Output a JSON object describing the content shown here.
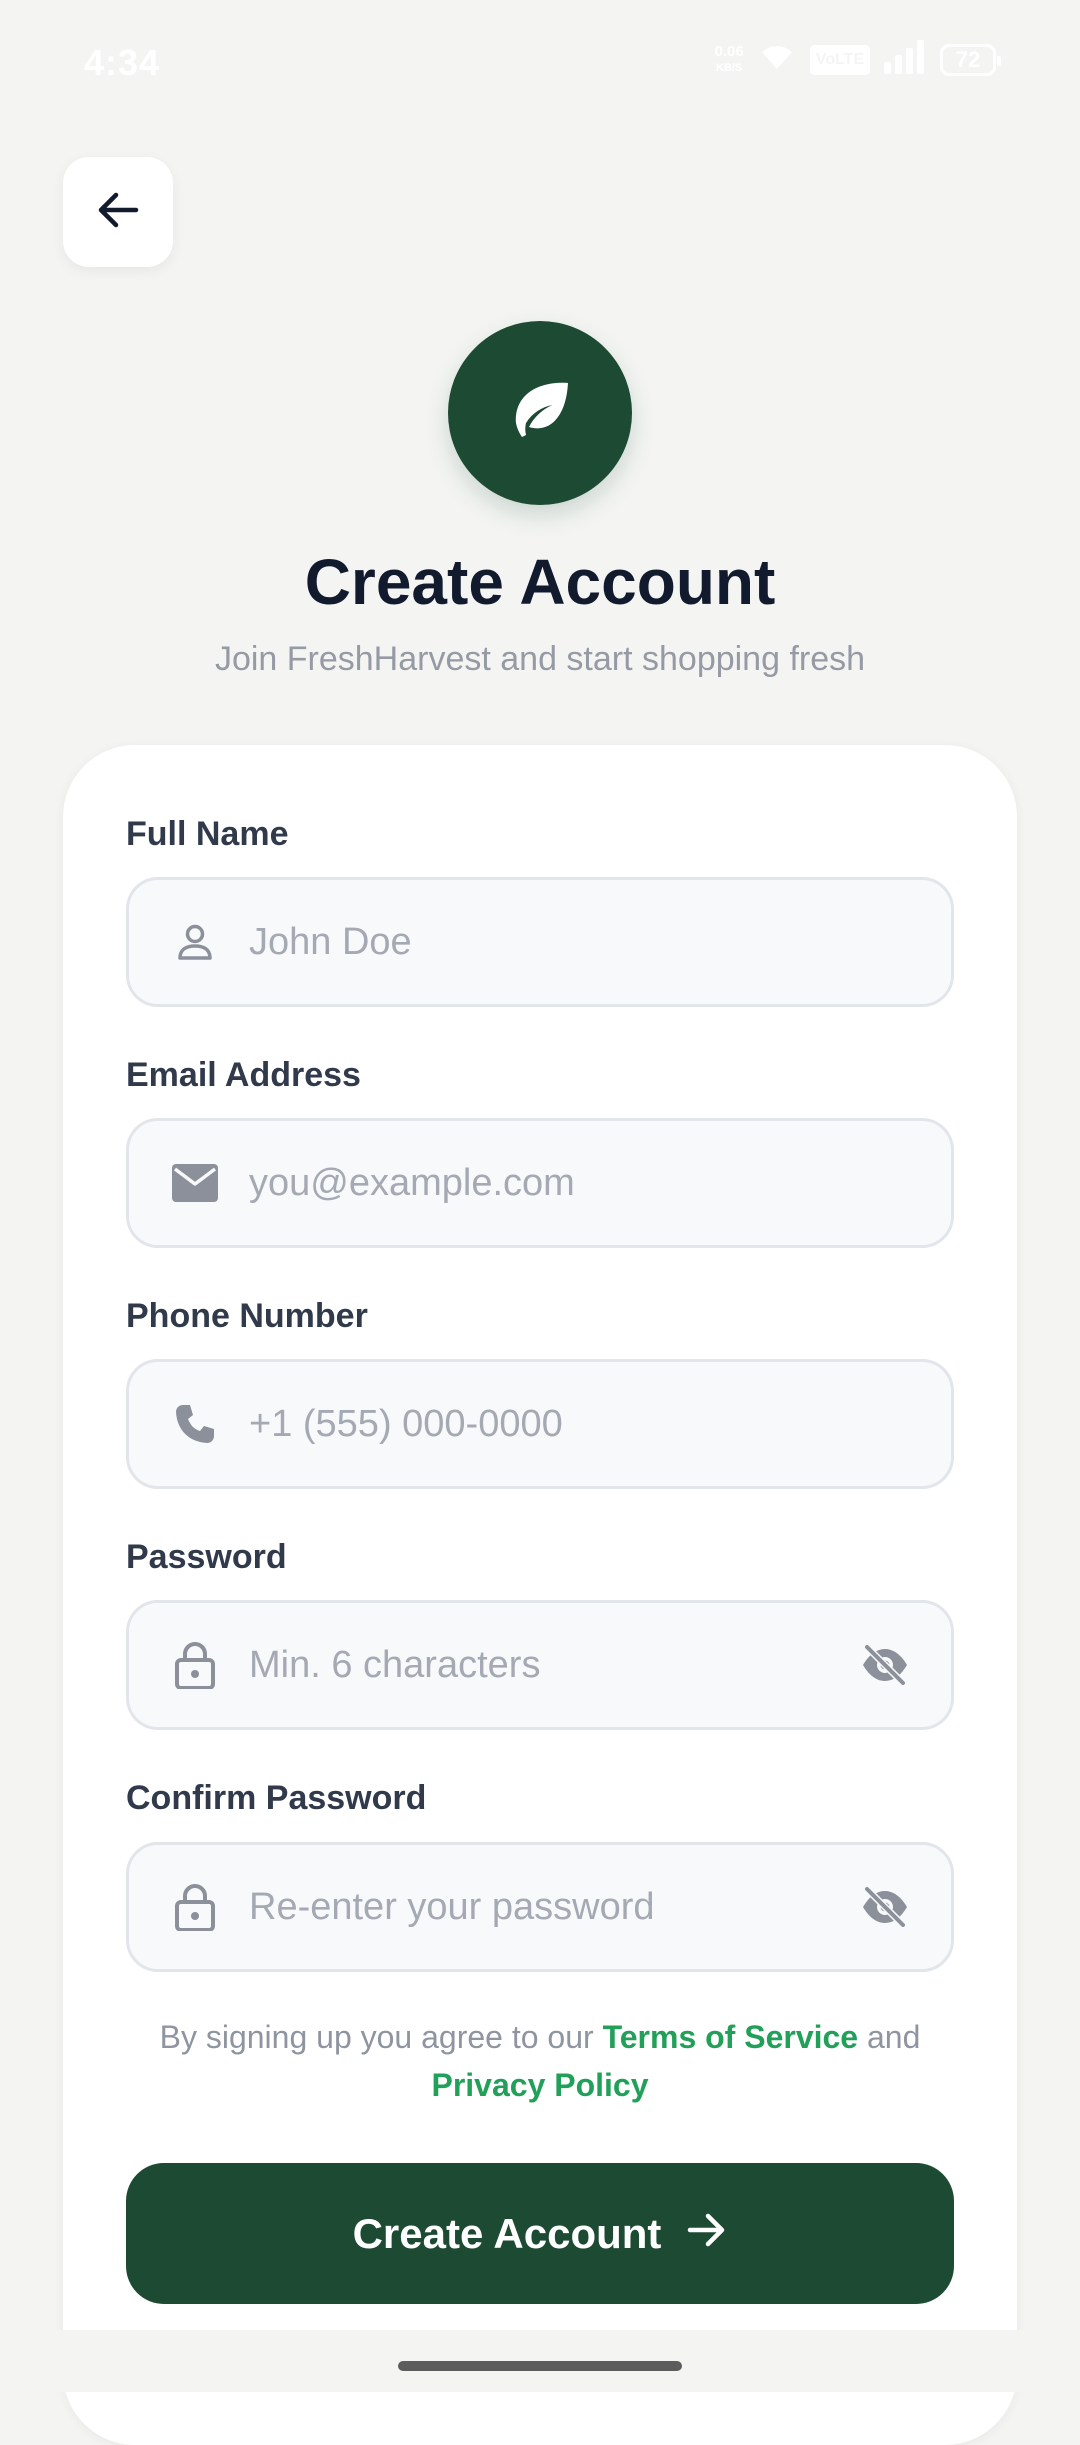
{
  "status_bar": {
    "time": "4:34",
    "net_speed_value": "0.06",
    "net_speed_unit": "KB/S",
    "volte_label": "VoLTE",
    "battery_level": "72"
  },
  "header": {
    "title": "Create Account",
    "subtitle": "Join FreshHarvest and start shopping fresh"
  },
  "form": {
    "full_name": {
      "label": "Full Name",
      "placeholder": "John Doe",
      "icon": "person-icon"
    },
    "email": {
      "label": "Email Address",
      "placeholder": "you@example.com",
      "icon": "mail-icon"
    },
    "phone": {
      "label": "Phone Number",
      "placeholder": "+1 (555) 000-0000",
      "icon": "phone-icon"
    },
    "password": {
      "label": "Password",
      "placeholder": "Min. 6 characters",
      "icon": "lock-icon"
    },
    "confirm_password": {
      "label": "Confirm Password",
      "placeholder": "Re-enter your password",
      "icon": "lock-icon"
    }
  },
  "terms": {
    "prefix": "By signing up you agree to our",
    "terms_link": "Terms of Service",
    "conjunction": "and",
    "privacy_link": "Privacy Policy"
  },
  "submit": {
    "label": "Create Account"
  },
  "colors": {
    "brand": "#1d4a33",
    "link": "#22a05a",
    "background": "#f4f5f3"
  }
}
